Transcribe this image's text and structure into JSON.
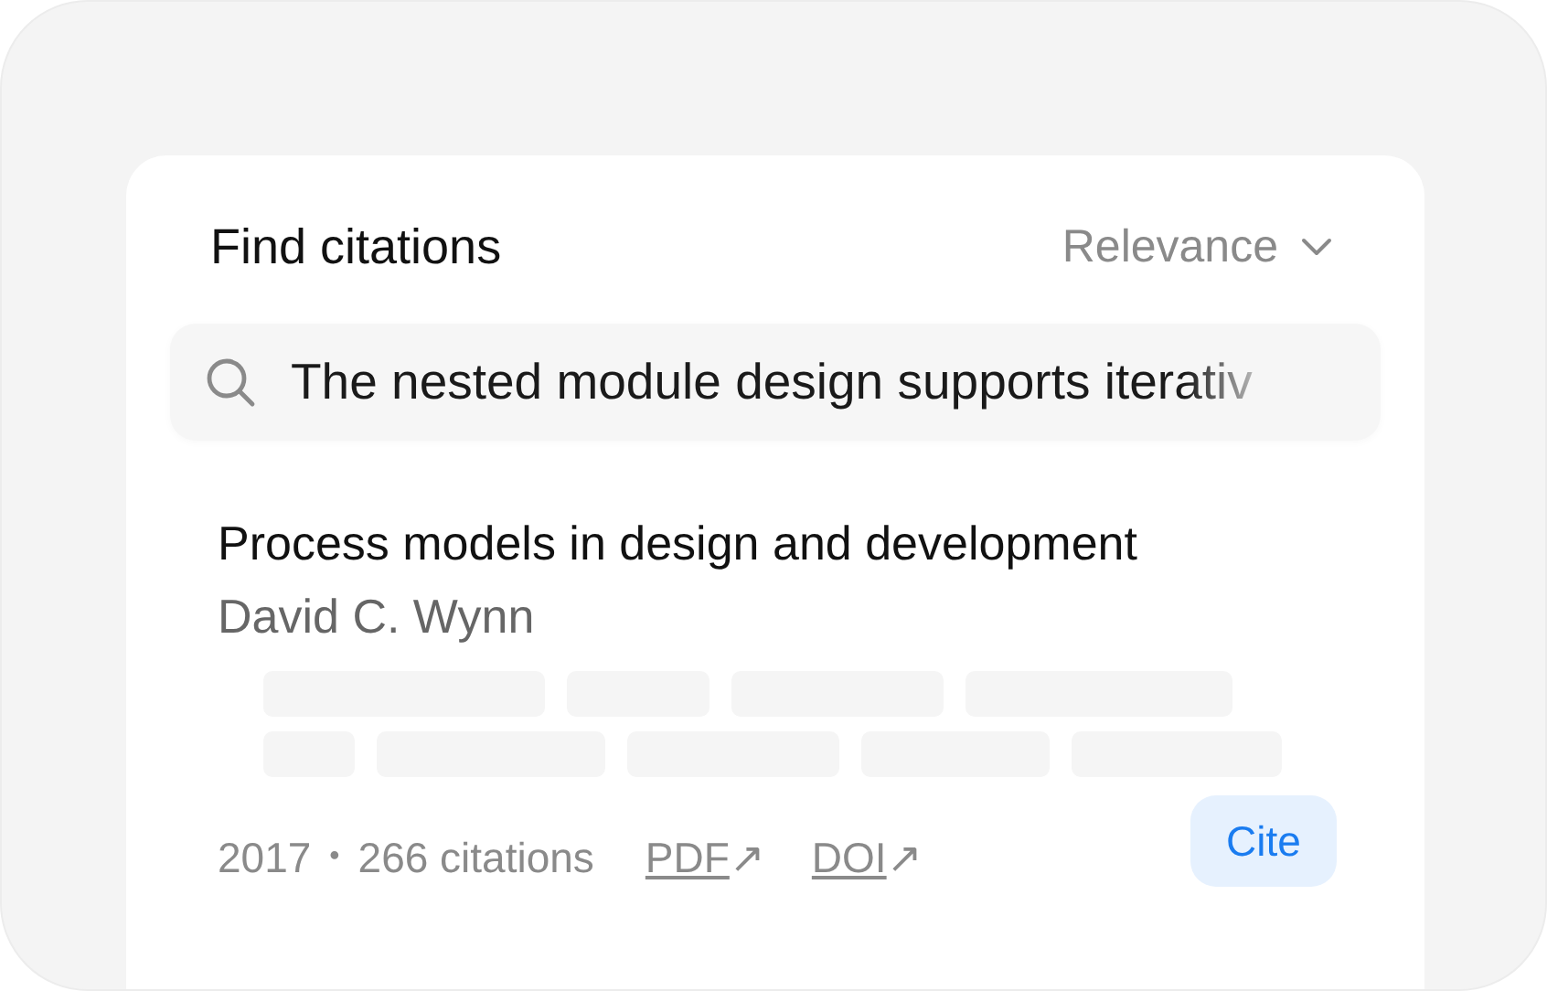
{
  "header": {
    "title": "Find citations",
    "sort": "Relevance"
  },
  "search": {
    "value": "The nested module design supports iterativ"
  },
  "result": {
    "title": "Process models in design and development",
    "author": "David C. Wynn",
    "year": "2017",
    "separator": "•",
    "citations": "266 citations",
    "links": [
      {
        "label": "PDF",
        "arrow": "↗"
      },
      {
        "label": "DOI",
        "arrow": "↗"
      }
    ],
    "cite_button": "Cite"
  }
}
